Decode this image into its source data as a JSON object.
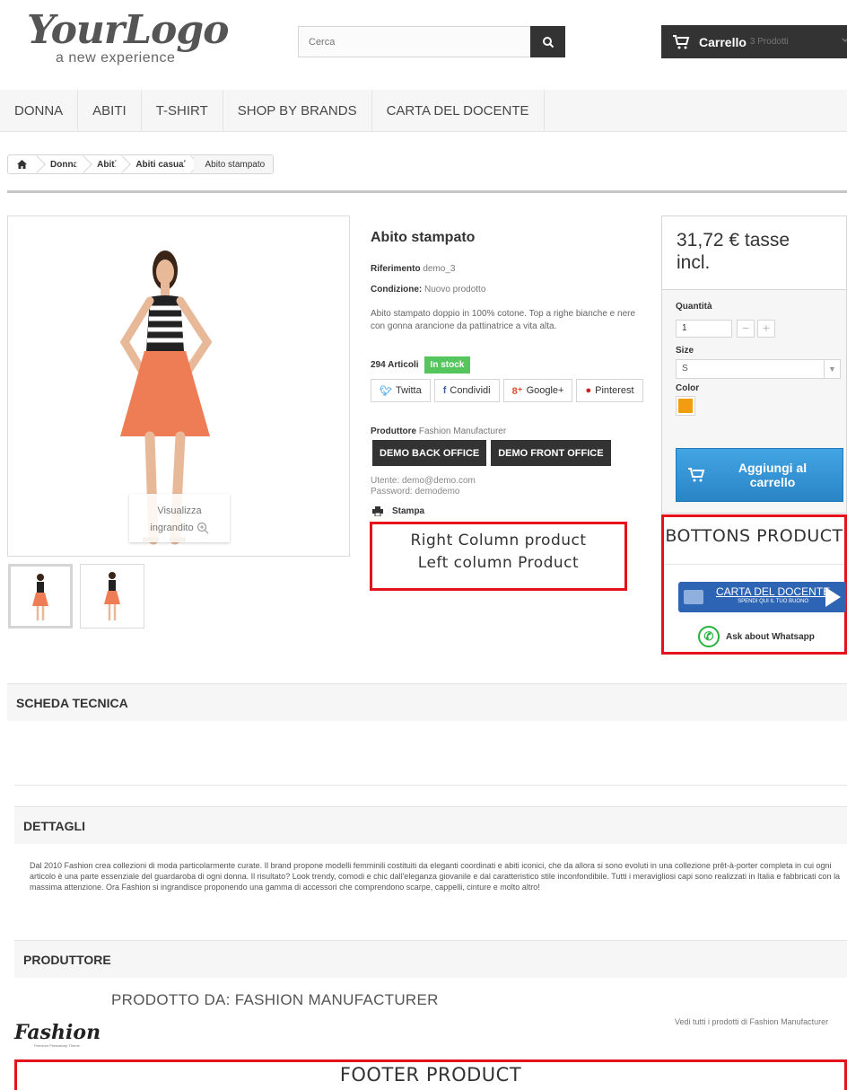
{
  "header": {
    "logo_main": "YourLogo",
    "logo_sub": "a new experience",
    "search_placeholder": "Cerca",
    "cart_label": "Carrello",
    "cart_count": "3 Prodotti"
  },
  "menu": {
    "items": [
      "DONNA",
      "ABITI",
      "T-SHIRT",
      "SHOP BY BRANDS",
      "CARTA DEL DOCENTE"
    ]
  },
  "breadcrumb": {
    "items": [
      "Donna",
      "Abiti",
      "Abiti casual"
    ],
    "current": "Abito stampato"
  },
  "gallery": {
    "zoom_line1": "Visualizza",
    "zoom_line2": "ingrandito"
  },
  "product": {
    "title": "Abito stampato",
    "reference_label": "Riferimento",
    "reference_value": "demo_3",
    "condition_label": "Condizione:",
    "condition_value": "Nuovo prodotto",
    "description": "Abito stampato doppio in 100% cotone. Top a righe bianche e nere con gonna arancione da pattinatrice a vita alta.",
    "quantity_text": "294 Articoli",
    "stock_badge": "In stock",
    "social": [
      "Twitta",
      "Condividi",
      "Google+",
      "Pinterest"
    ],
    "producer_label": "Produttore",
    "producer_value": "Fashion Manufacturer",
    "demo_back": "DEMO BACK OFFICE",
    "demo_front": "DEMO FRONT OFFICE",
    "user_line": "Utente: demo@demo.com",
    "password_line": "Password: demodemo",
    "print_label": "Stampa",
    "annotation_line1": "Right Column product",
    "annotation_line2": "Left column Product"
  },
  "buybox": {
    "price_line1": "31,72 € tasse",
    "price_line2": "incl.",
    "quantity_label": "Quantità",
    "quantity_value": "1",
    "size_label": "Size",
    "size_value": "S",
    "color_label": "Color",
    "swatch_color": "#f39c11",
    "add_to_cart_line1": "Aggiungi al",
    "add_to_cart_line2": "carrello",
    "annotation": "BOTTONS PRODUCT",
    "docente_line1": "CARTA DEL DOCENTE",
    "docente_line2": "SPENDI QUI IL TUO BUONO",
    "whatsapp": "Ask about Whatsapp"
  },
  "sections": {
    "scheda": "SCHEDA TECNICA",
    "dettagli": "DETTAGLI",
    "dettagli_text": "Dal 2010 Fashion crea collezioni di moda particolarmente curate. Il brand propone modelli femminili costituiti da eleganti coordinati e abiti iconici, che da allora si sono evoluti in una collezione prêt-à-porter completa in cui ogni articolo è una parte essenziale del guardaroba di ogni donna. Il risultato? Look trendy, comodi e chic dall'eleganza giovanile e dal caratteristico stile inconfondibile. Tutti i meravigliosi capi sono realizzati in Italia e fabbricati con la massima attenzione. Ora Fashion si ingrandisce proponendo una gamma di accessori che comprendono scarpe, cappelli, cinture e molto altro!",
    "produttore": "PRODUTTORE",
    "produced_by": "PRODOTTO DA: FASHION MANUFACTURER",
    "brand_logo": "Fashion",
    "brand_sub": "Premium Prestashop Theme",
    "see_all": "Vedi tutti i prodotti di Fashion Manufacturer",
    "footer_annotation": "FOOTER PRODUCT"
  },
  "colors": {
    "accent_blue": "#2a84c6",
    "stock_green": "#55c65e",
    "annotation_red": "#e4131b",
    "dark": "#333333"
  }
}
